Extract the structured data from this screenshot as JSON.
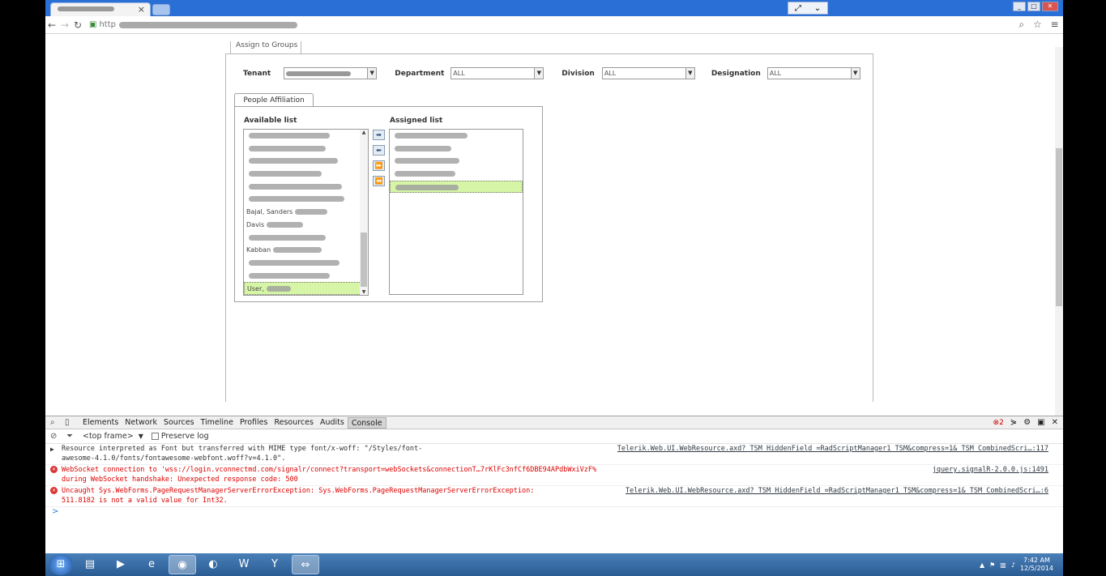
{
  "browser": {
    "tab_close": "×",
    "url_prefix": "http",
    "window_controls": [
      "_",
      "□",
      "✕"
    ]
  },
  "page": {
    "section_tab": "Assign to Groups",
    "filters": [
      {
        "label": "Tenant",
        "value": ""
      },
      {
        "label": "Department",
        "value": "ALL"
      },
      {
        "label": "Division",
        "value": "ALL"
      },
      {
        "label": "Designation",
        "value": "ALL"
      }
    ],
    "affiliation_tab": "People Affiliation",
    "available_title": "Available list",
    "assigned_title": "Assigned list",
    "available_items": [
      {
        "text": "",
        "selected": false
      },
      {
        "text": "",
        "selected": false
      },
      {
        "text": "",
        "selected": false
      },
      {
        "text": "",
        "selected": false
      },
      {
        "text": "",
        "selected": false
      },
      {
        "text": "",
        "selected": false
      },
      {
        "text": "Bajal, Sanders",
        "selected": false
      },
      {
        "text": "Davis",
        "selected": false
      },
      {
        "text": "",
        "selected": false
      },
      {
        "text": "Kabban",
        "selected": false
      },
      {
        "text": "",
        "selected": false
      },
      {
        "text": "",
        "selected": false
      },
      {
        "text": "User,",
        "selected": true
      }
    ],
    "assigned_items": [
      {
        "text": "",
        "selected": false
      },
      {
        "text": "",
        "selected": false
      },
      {
        "text": "",
        "selected": false
      },
      {
        "text": "",
        "selected": false
      },
      {
        "text": "",
        "selected": true
      }
    ],
    "move_buttons": [
      "➡",
      "⬅",
      "⏩",
      "⏪"
    ]
  },
  "devtools": {
    "tabs": [
      "Elements",
      "Network",
      "Sources",
      "Timeline",
      "Profiles",
      "Resources",
      "Audits",
      "Console"
    ],
    "active_tab": "Console",
    "error_count": "2",
    "frame_selector": "<top frame>",
    "preserve_log": "Preserve log",
    "messages": [
      {
        "type": "warn",
        "text": "Resource interpreted as Font but transferred with MIME type font/x-woff: \"/Styles/font-",
        "text2": "awesome-4.1.0/fonts/fontawesome-webfont.woff?v=4.1.0\".",
        "source": "Telerik.Web.UI.WebResource.axd?_TSM_HiddenField_=RadScriptManager1_TSM&compress=1&_TSM_CombinedScri…:117"
      },
      {
        "type": "error",
        "text": "WebSocket connection to 'wss://login.vconnectmd.com/signalr/connect?transport=webSockets&connectionT…7rKlFc3nfCf6DBE94APdbWxiVzF%2B0%2Fx9vui9Axkemd&connectionData=%5B%5D&tid=8' failed: Error",
        "text2": "during WebSocket handshake: Unexpected response code: 500",
        "source": "jquery.signalR-2.0.0.js:1491"
      },
      {
        "type": "error",
        "text": "Uncaught Sys.WebForms.PageRequestManagerServerErrorException: Sys.WebForms.PageRequestManagerServerErrorException:",
        "text2": "511.8182 is not a valid value for Int32.",
        "source": "Telerik.Web.UI.WebResource.axd?_TSM_HiddenField_=RadScriptManager1_TSM&compress=1&_TSM_CombinedScri…:6"
      }
    ],
    "prompt": ">"
  },
  "taskbar": {
    "time": "7:42 AM",
    "date": "12/5/2014",
    "apps": [
      "explorer-icon",
      "media-player-icon",
      "ie-icon",
      "chrome-icon",
      "firefox-icon",
      "word-icon",
      "yahoo-icon",
      "teamviewer-icon"
    ]
  }
}
